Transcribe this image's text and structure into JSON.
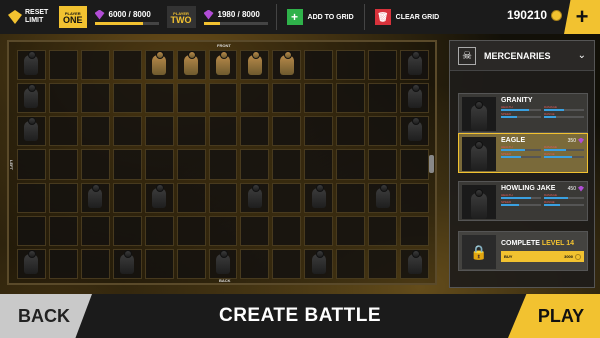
{
  "topbar": {
    "reset_label": "RESET LIMIT",
    "player_one": {
      "small": "PLAYER",
      "label": "ONE",
      "budget": "6000 / 8000",
      "fill": 0.75
    },
    "player_two": {
      "small": "PLAYER",
      "label": "TWO",
      "budget": "1980 / 8000",
      "fill": 0.25
    },
    "add_to_grid": "ADD TO GRID",
    "clear_grid": "CLEAR GRID",
    "coins": "190210",
    "plus": "+"
  },
  "grid": {
    "front_label": "FRONT",
    "back_label": "BACK",
    "left_label": "LEFT",
    "rows": 7,
    "cols": 13,
    "units": [
      {
        "r": 0,
        "c": 0,
        "team": "dark"
      },
      {
        "r": 0,
        "c": 4,
        "team": "tan"
      },
      {
        "r": 0,
        "c": 5,
        "team": "tan"
      },
      {
        "r": 0,
        "c": 6,
        "team": "tan"
      },
      {
        "r": 0,
        "c": 7,
        "team": "tan"
      },
      {
        "r": 0,
        "c": 8,
        "team": "tan"
      },
      {
        "r": 0,
        "c": 12,
        "team": "dark"
      },
      {
        "r": 1,
        "c": 0,
        "team": "dark"
      },
      {
        "r": 1,
        "c": 12,
        "team": "dark"
      },
      {
        "r": 2,
        "c": 0,
        "team": "dark"
      },
      {
        "r": 2,
        "c": 12,
        "team": "dark"
      },
      {
        "r": 4,
        "c": 2,
        "team": "dark"
      },
      {
        "r": 4,
        "c": 4,
        "team": "dark"
      },
      {
        "r": 4,
        "c": 7,
        "team": "dark"
      },
      {
        "r": 4,
        "c": 9,
        "team": "dark"
      },
      {
        "r": 4,
        "c": 11,
        "team": "dark"
      },
      {
        "r": 6,
        "c": 0,
        "team": "dark"
      },
      {
        "r": 6,
        "c": 3,
        "team": "dark"
      },
      {
        "r": 6,
        "c": 6,
        "team": "dark"
      },
      {
        "r": 6,
        "c": 9,
        "team": "dark"
      },
      {
        "r": 6,
        "c": 12,
        "team": "dark"
      }
    ]
  },
  "side": {
    "title": "MERCENARIES",
    "cards": [
      {
        "name": "GRANITY",
        "cost": "",
        "selected": false,
        "health": 0.7,
        "damage": 0.5,
        "speed": 0.4,
        "range": 0.3
      },
      {
        "name": "EAGLE",
        "cost": "350",
        "selected": true,
        "health": 0.6,
        "damage": 0.55,
        "speed": 0.5,
        "range": 0.7
      },
      {
        "name": "HOWLING JAKE",
        "cost": "450",
        "selected": false,
        "health": 0.75,
        "damage": 0.6,
        "speed": 0.45,
        "range": 0.4
      }
    ],
    "stat_labels": {
      "health": "HEALTH",
      "damage": "DAMAGE",
      "speed": "SPEED",
      "range": "RANGE"
    },
    "locked": {
      "complete": "COMPLETE",
      "level": "LEVEL 14",
      "buy": "BUY",
      "price": "3000"
    }
  },
  "bottom": {
    "back": "BACK",
    "title": "CREATE BATTLE",
    "play": "PLAY"
  },
  "colors": {
    "accent": "#f2c230",
    "gem": "#b14dd6",
    "add": "#2fb24a",
    "clear": "#d8323b"
  }
}
